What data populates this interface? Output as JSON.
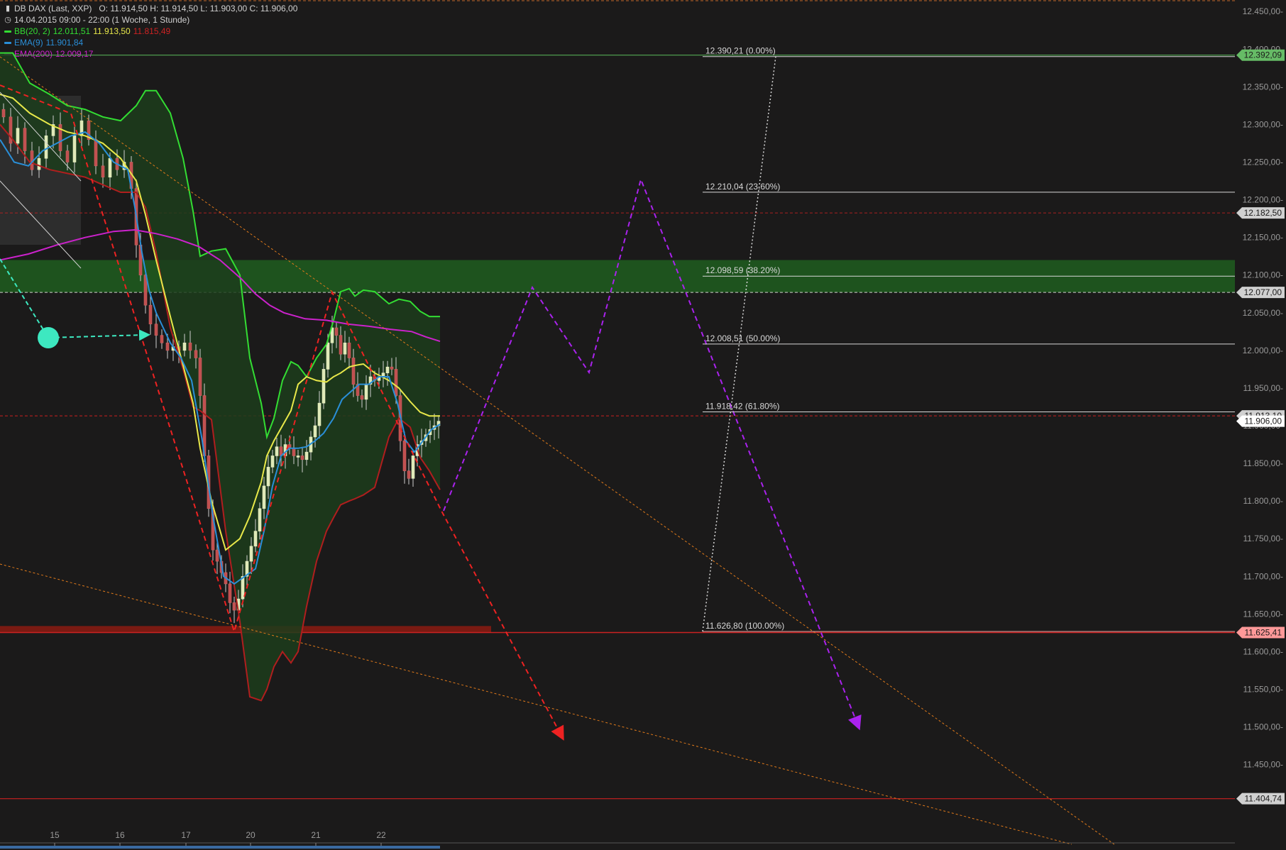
{
  "header": {
    "symbol": "DB DAX (Last, XXP)",
    "ohlc": "O: 11.914,50  H: 11.914,50  L: 11.903,00  C: 11.906,00",
    "period": "14.04.2015 09:00 - 22:00 (1 Woche, 1 Stunde)",
    "indicators": [
      {
        "name": "BB(20, 2)",
        "color": "#33dd33",
        "values": [
          {
            "text": "12.011,51",
            "color": "#33dd33"
          },
          {
            "text": "11.913,50",
            "color": "#e8e84a"
          },
          {
            "text": "11.815,49",
            "color": "#cc2222"
          }
        ]
      },
      {
        "name": "EMA(9)",
        "color": "#2a8fd8",
        "values": [
          {
            "text": "11.901,84",
            "color": "#2a8fd8"
          }
        ]
      },
      {
        "name": "EMA(200)",
        "color": "#cc22cc",
        "values": [
          {
            "text": "12.009,17",
            "color": "#cc22cc"
          }
        ]
      }
    ]
  },
  "chart_data": {
    "type": "candlestick",
    "y_range": [
      11360,
      12475
    ],
    "y_ticks": [
      {
        "value": 12450,
        "label": "12.450,00-"
      },
      {
        "value": 12400,
        "label": "12.400,00-"
      },
      {
        "value": 12350,
        "label": "12.350,00-"
      },
      {
        "value": 12300,
        "label": "12.300,00-"
      },
      {
        "value": 12250,
        "label": "12.250,00-"
      },
      {
        "value": 12200,
        "label": "12.200,00-"
      },
      {
        "value": 12150,
        "label": "12.150,00-"
      },
      {
        "value": 12100,
        "label": "12.100,00-"
      },
      {
        "value": 12050,
        "label": "12.050,00-"
      },
      {
        "value": 12000,
        "label": "12.000,00-"
      },
      {
        "value": 11950,
        "label": "11.950,00-"
      },
      {
        "value": 11900,
        "label": "11.900,00-"
      },
      {
        "value": 11850,
        "label": "11.850,00-"
      },
      {
        "value": 11800,
        "label": "11.800,00-"
      },
      {
        "value": 11750,
        "label": "11.750,00-"
      },
      {
        "value": 11700,
        "label": "11.700,00-"
      },
      {
        "value": 11650,
        "label": "11.650,00-"
      },
      {
        "value": 11600,
        "label": "11.600,00-"
      },
      {
        "value": 11550,
        "label": "11.550,00-"
      },
      {
        "value": 11500,
        "label": "11.500,00-"
      },
      {
        "value": 11450,
        "label": "11.450,00-"
      }
    ],
    "x_labels": [
      "15",
      "16",
      "17",
      "20",
      "21",
      "22"
    ],
    "price_badges": [
      {
        "value": 12392.09,
        "label": "12.392,09",
        "color": "#66bb66"
      },
      {
        "value": 12182.5,
        "label": "12.182,50",
        "color": "#d0d0d0"
      },
      {
        "value": 12077.0,
        "label": "12.077,00",
        "color": "#d0d0d0"
      },
      {
        "value": 11913.1,
        "label": "11.913,10",
        "color": "#d0d0d0"
      },
      {
        "value": 11906.0,
        "label": "11.906,00",
        "color": "#ffffff"
      },
      {
        "value": 11625.41,
        "label": "11.625,41",
        "color": "#ff9999"
      },
      {
        "value": 11404.74,
        "label": "11.404,74",
        "color": "#d0d0d0"
      }
    ],
    "fibonacci": [
      {
        "value": 12390.21,
        "label": "12.390,21 (0.00%)"
      },
      {
        "value": 12210.04,
        "label": "12.210,04 (23.60%)"
      },
      {
        "value": 12098.59,
        "label": "12.098,59 (38.20%)"
      },
      {
        "value": 12008.51,
        "label": "12.008,51 (50.00%)"
      },
      {
        "value": 11918.42,
        "label": "11.918,42 (61.80%)"
      },
      {
        "value": 11626.8,
        "label": "11.626,80 (100.00%)"
      }
    ],
    "support_zone": [
      12077,
      12120
    ],
    "resistance_zone": [
      11625,
      11634
    ],
    "colors": {
      "bb_upper": "#33dd33",
      "bb_mid": "#e8e84a",
      "bb_lower": "#b01e1e",
      "ema9": "#2a8fd8",
      "ema200": "#cc22cc",
      "projection_red": "#ee2222",
      "projection_purple": "#aa22ee",
      "cyan": "#3de8c0",
      "orange": "#e07a1a"
    },
    "last_close": 11906.0
  }
}
